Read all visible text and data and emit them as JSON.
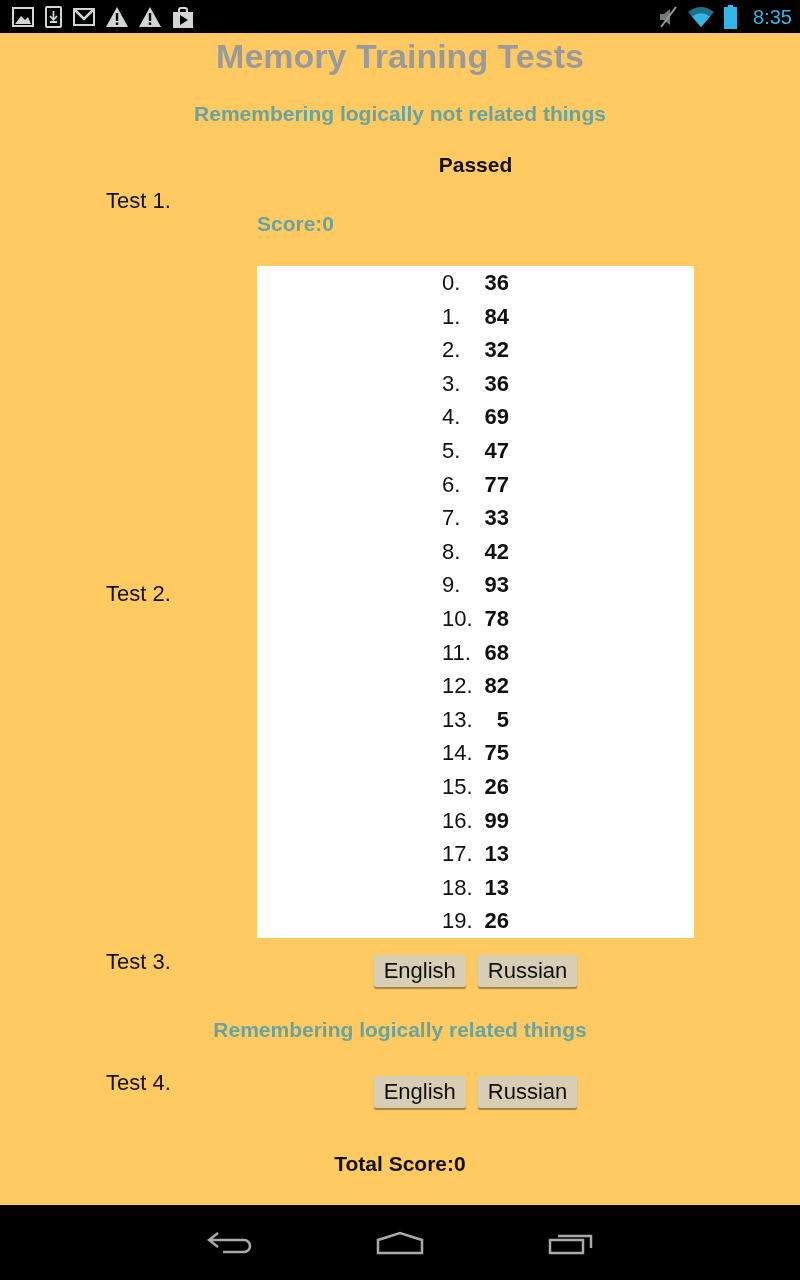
{
  "status_bar": {
    "time": "8:35"
  },
  "title": "Memory Training Tests",
  "sections": [
    {
      "heading": "Remembering logically not related things",
      "tests": [
        {
          "label": "Test 1.",
          "kind": "result",
          "status": "Passed",
          "score": "Score:0"
        },
        {
          "label": "Test 2.",
          "kind": "numbers",
          "items": [
            {
              "index": "0.",
              "value": "36"
            },
            {
              "index": "1.",
              "value": "84"
            },
            {
              "index": "2.",
              "value": "32"
            },
            {
              "index": "3.",
              "value": "36"
            },
            {
              "index": "4.",
              "value": "69"
            },
            {
              "index": "5.",
              "value": "47"
            },
            {
              "index": "6.",
              "value": "77"
            },
            {
              "index": "7.",
              "value": "33"
            },
            {
              "index": "8.",
              "value": "42"
            },
            {
              "index": "9.",
              "value": "93"
            },
            {
              "index": "10.",
              "value": "78"
            },
            {
              "index": "11.",
              "value": "68"
            },
            {
              "index": "12.",
              "value": "82"
            },
            {
              "index": "13.",
              "value": "5"
            },
            {
              "index": "14.",
              "value": "75"
            },
            {
              "index": "15.",
              "value": "26"
            },
            {
              "index": "16.",
              "value": "99"
            },
            {
              "index": "17.",
              "value": "13"
            },
            {
              "index": "18.",
              "value": "13"
            },
            {
              "index": "19.",
              "value": "26"
            }
          ]
        },
        {
          "label": "Test 3.",
          "kind": "languages",
          "buttons": [
            "English",
            "Russian"
          ]
        }
      ]
    },
    {
      "heading": "Remembering logically related things",
      "tests": [
        {
          "label": "Test 4.",
          "kind": "languages",
          "buttons": [
            "English",
            "Russian"
          ]
        }
      ]
    }
  ],
  "total_score": "Total Score:0"
}
